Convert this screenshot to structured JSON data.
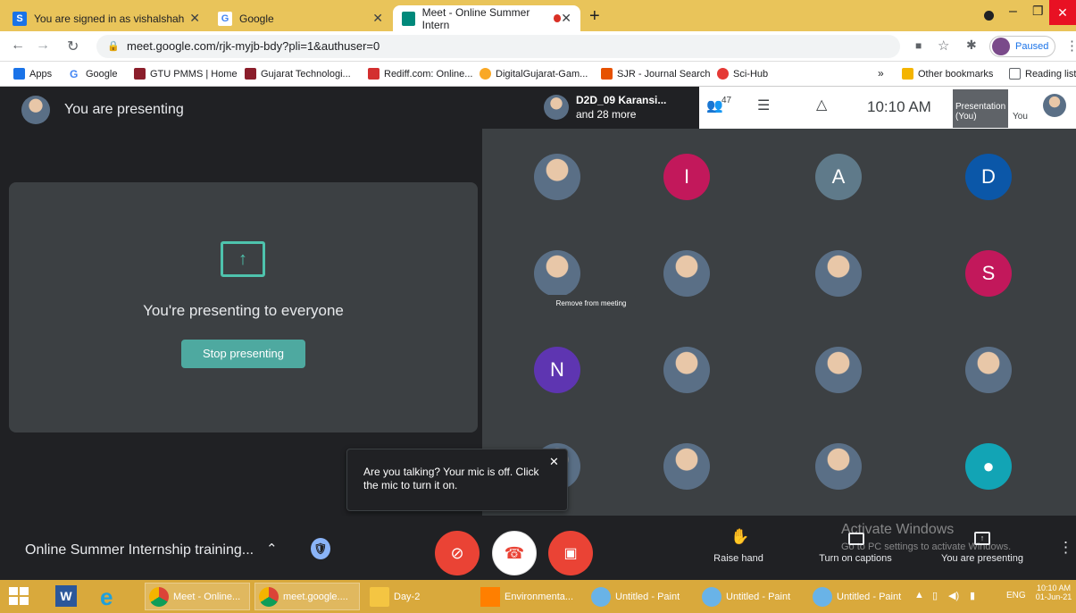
{
  "browser": {
    "tabs": [
      {
        "label": "You are signed in as vishalshah",
        "favicon": "S"
      },
      {
        "label": "Google",
        "favicon": "G"
      },
      {
        "label": "Meet - Online Summer Intern",
        "favicon": "meet"
      }
    ],
    "url": "meet.google.com/rjk-myjb-bdy?pli=1&authuser=0",
    "profile_status": "Paused",
    "bookmarks": [
      "Apps",
      "Google",
      "GTU PMMS | Home",
      "Gujarat Technologi...",
      "Rediff.com: Online...",
      "DigitalGujarat-Gam...",
      "SJR - Journal Search",
      "Sci-Hub"
    ],
    "other_bookmarks": "Other bookmarks",
    "reading_list": "Reading list",
    "more": "»"
  },
  "meet": {
    "presenting_banner": "You are presenting",
    "presenting_heading": "You're presenting to everyone",
    "stop_button": "Stop presenting",
    "call_participant": "D2D_09 Karansi...",
    "call_more": "and 28 more",
    "participant_count": "47",
    "time": "10:10 AM",
    "self_tile_label": "Presentation (You)",
    "self_label": "You",
    "tooltip": "Remove from meeting",
    "tiles": [
      {
        "type": "photo"
      },
      {
        "type": "letter",
        "letter": "I",
        "color": "#c2185b"
      },
      {
        "type": "letter",
        "letter": "A",
        "color": "#5f7a8a"
      },
      {
        "type": "letter",
        "letter": "D",
        "color": "#0b57a8"
      },
      {
        "type": "photo"
      },
      {
        "type": "photo"
      },
      {
        "type": "photo"
      },
      {
        "type": "letter",
        "letter": "S",
        "color": "#c2185b"
      },
      {
        "type": "letter",
        "letter": "N",
        "color": "#5e35b1"
      },
      {
        "type": "photo"
      },
      {
        "type": "photo"
      },
      {
        "type": "photo"
      },
      {
        "type": "photo"
      },
      {
        "type": "photo"
      },
      {
        "type": "photo"
      },
      {
        "type": "person",
        "color": "#12a4b5"
      }
    ],
    "mic_notice": "Are you talking? Your mic is off. Click the mic to turn it on.",
    "meeting_title": "Online Summer Internship training...",
    "raise_hand": "Raise hand",
    "captions": "Turn on captions",
    "you_presenting": "You are presenting",
    "watermark_title": "Activate Windows",
    "watermark_sub": "Go to PC settings to activate Windows."
  },
  "taskbar": {
    "items": [
      "Meet - Online...",
      "meet.google....",
      "Day-2",
      "Environmenta...",
      "Untitled - Paint",
      "Untitled - Paint",
      "Untitled - Paint"
    ],
    "lang": "ENG",
    "clock_time": "10:10 AM",
    "clock_date": "01-Jun-21"
  }
}
